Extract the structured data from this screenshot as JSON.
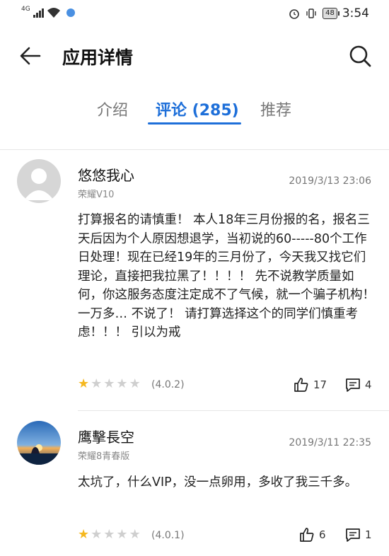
{
  "status_bar": {
    "network": "4G",
    "battery": "48",
    "time": "3:54"
  },
  "header": {
    "title": "应用详情"
  },
  "tabs": [
    {
      "label": "介绍"
    },
    {
      "label": "评论 (285)"
    },
    {
      "label": "推荐"
    }
  ],
  "reviews": [
    {
      "name": "悠悠我心",
      "device": "荣耀V10",
      "date": "2019/3/13 23:06",
      "text": "打算报名的请慎重！ 本人18年三月份报的名，报名三天后因为个人原因想退学，当初说的60-----80个工作日处理！现在已经19年的三月份了，今天我又找它们理论，直接把我拉黑了！！！！ 先不说教学质量如何，你这服务态度注定成不了气候，就一个骗子机构！ 一万多… 不说了！ 请打算选择这个的同学们慎重考虑！！！ 引以为戒",
      "rating": 1,
      "version": "(4.0.2)",
      "likes": "17",
      "comments": "4"
    },
    {
      "name": "鹰擊長空",
      "device": "荣耀8青春版",
      "date": "2019/3/11 22:35",
      "text": "太坑了，什么VIP，没一点卵用，多收了我三千多。",
      "rating": 1,
      "version": "(4.0.1)",
      "likes": "6",
      "comments": "1"
    }
  ],
  "colors": {
    "accent": "#1e6fd9",
    "star": "#f5b820"
  }
}
